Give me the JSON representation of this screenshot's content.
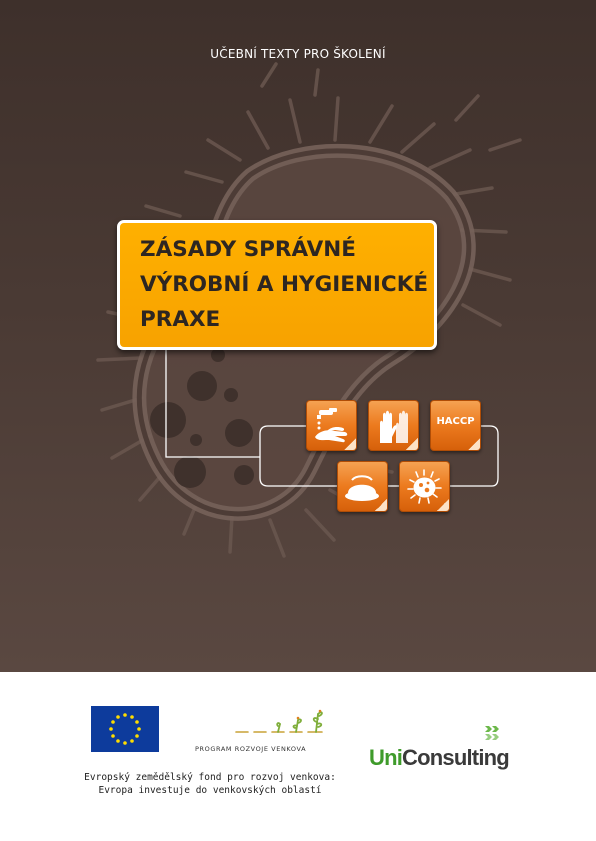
{
  "cover": {
    "series_label": "UČEBNÍ TEXTY PRO ŠKOLENÍ",
    "title_lines": [
      "ZÁSADY SPRÁVNÉ",
      "VÝROBNÍ A HYGIENICKÉ",
      "PRAXE"
    ],
    "icons": [
      {
        "name": "hand-washing-icon",
        "label": ""
      },
      {
        "name": "gloves-icon",
        "label": ""
      },
      {
        "name": "haccp-icon",
        "label": "HACCP"
      },
      {
        "name": "food-dish-icon",
        "label": ""
      },
      {
        "name": "bacterium-icon",
        "label": ""
      }
    ],
    "colors": {
      "background": "#4a3a34",
      "title_box": "#ffac00",
      "tiles": "#ec7a1e"
    }
  },
  "footer": {
    "eu_flag": {
      "name": "eu-flag-icon"
    },
    "program_logo_text": "PROGRAM ROZVOJE VENKOVA",
    "fund_lines": [
      "Evropský zemědělský fond pro rozvoj venkova:",
      "Evropa investuje do venkovských oblastí"
    ],
    "uniconsulting": {
      "part1": "Uni",
      "part2": "Consulting",
      "color1": "#3f9b2b",
      "color2": "#3a3a3a"
    }
  }
}
